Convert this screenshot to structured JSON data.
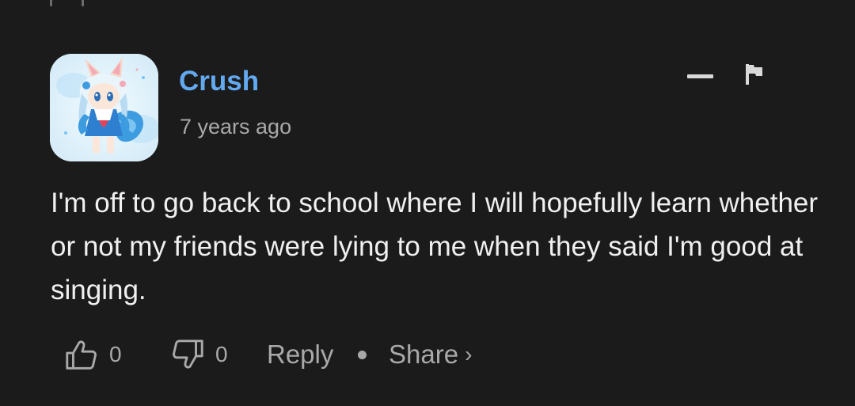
{
  "comment": {
    "author": "Crush",
    "timestamp": "7 years ago",
    "text": "I'm off to go back to school where I will hopefully learn whether or not my friends were lying to me when they said I'm good at singing.",
    "avatar_icon": "anime-character-avatar",
    "author_color": "#62a9f0"
  },
  "header_actions": {
    "collapse_icon": "minus-icon",
    "report_icon": "flag-icon"
  },
  "actions": {
    "like_icon": "thumbs-up-icon",
    "like_count": "0",
    "dislike_icon": "thumbs-down-icon",
    "dislike_count": "0",
    "reply_label": "Reply",
    "separator": "•",
    "share_label": "Share",
    "share_chevron": "›"
  },
  "colors": {
    "background": "#1b1b1b",
    "text": "#f0f0f0",
    "muted": "#a9a9a9"
  }
}
